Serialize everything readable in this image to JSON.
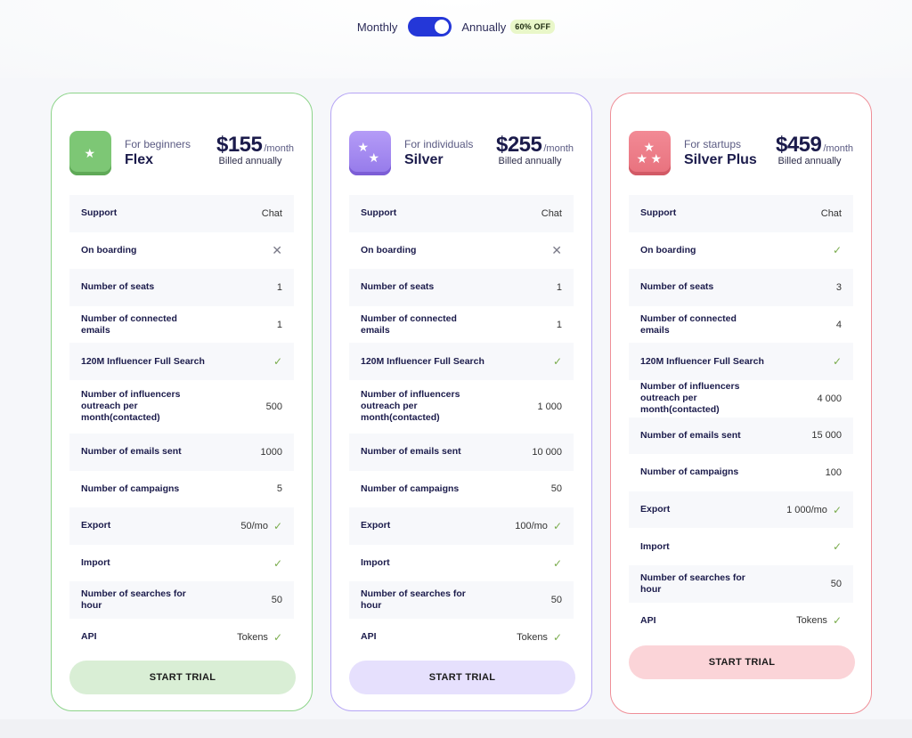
{
  "billing_toggle": {
    "monthly_label": "Monthly",
    "annually_label": "Annually",
    "selected": "Annually",
    "discount_badge": "60% OFF",
    "accent_color": "#2437d8"
  },
  "plans": [
    {
      "id": "flex",
      "audience": "For beginners",
      "name": "Flex",
      "price": "$155",
      "period": "/month",
      "billing_note": "Billed annually",
      "icon": "one-star-icon",
      "accent_color": "#8dd48a",
      "cta_label": "START TRIAL",
      "features": [
        {
          "label": "Support",
          "value": "Chat",
          "icon": null
        },
        {
          "label": "On boarding",
          "value": "",
          "icon": "x-icon"
        },
        {
          "label": "Number of seats",
          "value": "1",
          "icon": null
        },
        {
          "label": "Number of connected emails",
          "value": "1",
          "icon": null
        },
        {
          "label": "120M Influencer Full Search",
          "value": "",
          "icon": "check-icon"
        },
        {
          "label": "Number of influencers outreach per month(contacted)",
          "value": "500",
          "icon": null
        },
        {
          "label": "Number of emails sent",
          "value": "1000",
          "icon": null
        },
        {
          "label": "Number of campaigns",
          "value": "5",
          "icon": null
        },
        {
          "label": "Export",
          "value": "50/mo",
          "icon": "check-icon"
        },
        {
          "label": "Import",
          "value": "",
          "icon": "check-icon"
        },
        {
          "label": "Number of searches for hour",
          "value": "50",
          "icon": null
        },
        {
          "label": "API",
          "value": "Tokens",
          "icon": "check-icon"
        }
      ]
    },
    {
      "id": "silver",
      "audience": "For individuals",
      "name": "Silver",
      "price": "$255",
      "period": "/month",
      "billing_note": "Billed annually",
      "icon": "two-stars-icon",
      "accent_color": "#b6a5f5",
      "cta_label": "START TRIAL",
      "features": [
        {
          "label": "Support",
          "value": "Chat",
          "icon": null
        },
        {
          "label": "On boarding",
          "value": "",
          "icon": "x-icon"
        },
        {
          "label": "Number of seats",
          "value": "1",
          "icon": null
        },
        {
          "label": "Number of connected emails",
          "value": "1",
          "icon": null
        },
        {
          "label": "120M Influencer Full Search",
          "value": "",
          "icon": "check-icon"
        },
        {
          "label": "Number of influencers outreach per month(contacted)",
          "value": "1 000",
          "icon": null
        },
        {
          "label": "Number of emails sent",
          "value": "10 000",
          "icon": null
        },
        {
          "label": "Number of campaigns",
          "value": "50",
          "icon": null
        },
        {
          "label": "Export",
          "value": "100/mo",
          "icon": "check-icon"
        },
        {
          "label": "Import",
          "value": "",
          "icon": "check-icon"
        },
        {
          "label": "Number of searches for hour",
          "value": "50",
          "icon": null
        },
        {
          "label": "API",
          "value": "Tokens",
          "icon": "check-icon"
        }
      ]
    },
    {
      "id": "silver-plus",
      "audience": "For startups",
      "name": "Silver Plus",
      "price": "$459",
      "period": "/month",
      "billing_note": "Billed annually",
      "icon": "three-stars-icon",
      "accent_color": "#ef8f98",
      "cta_label": "START TRIAL",
      "features": [
        {
          "label": "Support",
          "value": "Chat",
          "icon": null
        },
        {
          "label": "On boarding",
          "value": "",
          "icon": "check-icon"
        },
        {
          "label": "Number of seats",
          "value": "3",
          "icon": null
        },
        {
          "label": "Number of connected emails",
          "value": "4",
          "icon": null
        },
        {
          "label": "120M Influencer Full Search",
          "value": "",
          "icon": "check-icon"
        },
        {
          "label": "Number of influencers outreach per month(contacted)",
          "value": "4 000",
          "icon": null
        },
        {
          "label": "Number of emails sent",
          "value": "15 000",
          "icon": null
        },
        {
          "label": "Number of campaigns",
          "value": "100",
          "icon": null
        },
        {
          "label": "Export",
          "value": "1 000/mo",
          "icon": "check-icon"
        },
        {
          "label": "Import",
          "value": "",
          "icon": "check-icon"
        },
        {
          "label": "Number of searches for hour",
          "value": "50",
          "icon": null
        },
        {
          "label": "API",
          "value": "Tokens",
          "icon": "check-icon"
        }
      ]
    }
  ]
}
